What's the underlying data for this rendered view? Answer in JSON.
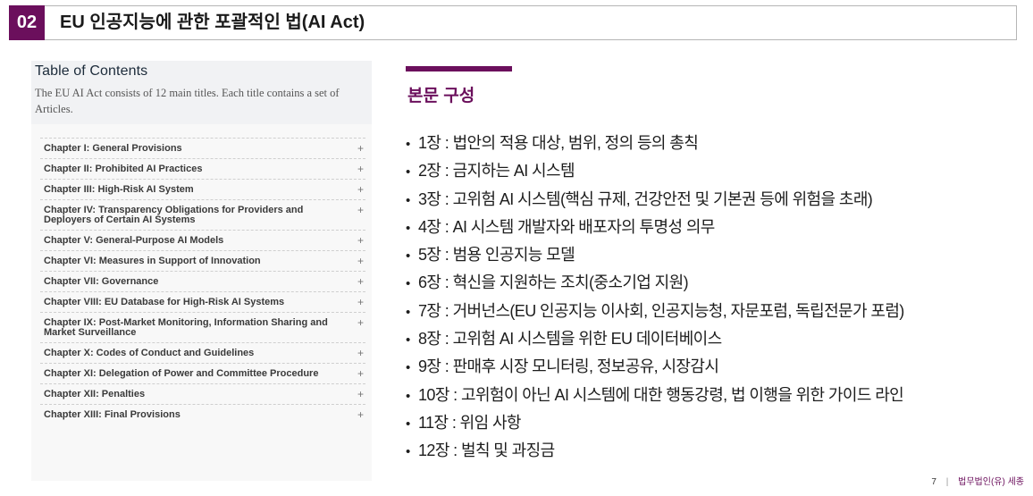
{
  "header": {
    "number": "02",
    "title": "EU 인공지능에 관한 포괄적인 법(AI Act)"
  },
  "toc": {
    "title": "Table of Contents",
    "description": "The EU AI Act consists of 12 main titles. Each title contains a set of Articles.",
    "expand_symbol": "+",
    "chapters": [
      "Chapter I: General Provisions",
      "Chapter II: Prohibited AI Practices",
      "Chapter III: High-Risk AI System",
      "Chapter IV: Transparency Obligations for Providers and Deployers of Certain AI Systems",
      "Chapter V: General-Purpose AI Models",
      "Chapter VI: Measures in Support of Innovation",
      "Chapter VII: Governance",
      "Chapter VIII: EU Database for High-Risk AI Systems",
      "Chapter IX: Post-Market Monitoring, Information Sharing and Market Surveillance",
      "Chapter X: Codes of Conduct and Guidelines",
      "Chapter XI: Delegation of Power and Committee Procedure",
      "Chapter XII: Penalties",
      "Chapter XIII: Final Provisions"
    ]
  },
  "content": {
    "section_title": "본문 구성",
    "bullet": "•",
    "items": [
      "1장 : 법안의 적용 대상, 범위, 정의 등의 총칙",
      "2장 : 금지하는 AI 시스템",
      "3장 :  고위험 AI 시스템(핵심 규제, 건강안전 및 기본권 등에 위험을 초래)",
      "4장 :  AI 시스템 개발자와 배포자의 투명성 의무",
      "5장 : 범용 인공지능 모델",
      "6장 : 혁신을 지원하는 조치(중소기업 지원)",
      "7장 : 거버넌스(EU 인공지능 이사회, 인공지능청, 자문포럼, 독립전문가 포럼)",
      "8장 :  고위험 AI 시스템을 위한 EU 데이터베이스",
      "9장 :  판매후 시장 모니터링, 정보공유, 시장감시",
      "10장 : 고위험이 아닌 AI 시스템에 대한 행동강령, 법 이행을 위한 가이드 라인",
      "11장 : 위임 사항",
      "12장 : 벌칙 및 과징금"
    ]
  },
  "footer": {
    "page": "7",
    "separator": "|",
    "firm": "법무법인(유) 세종"
  }
}
